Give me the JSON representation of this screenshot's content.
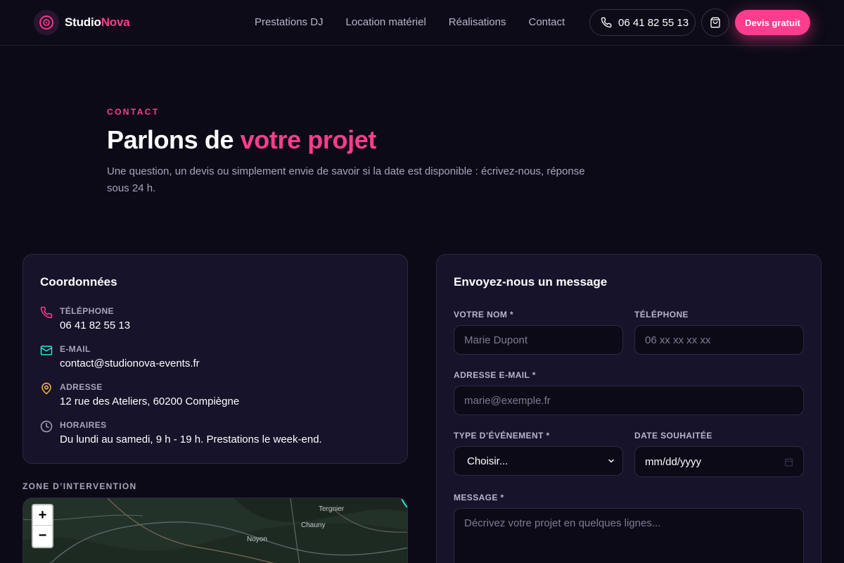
{
  "header": {
    "logo_part1": "Studio",
    "logo_part2": "Nova",
    "nav": [
      "Prestations DJ",
      "Location matériel",
      "Réalisations",
      "Contact"
    ],
    "phone": "06 41 82 55 13",
    "cta": "Devis gratuit"
  },
  "hero": {
    "eyebrow": "CONTACT",
    "title_plain": "Parlons de ",
    "title_highlight": "votre projet",
    "lead": "Une question, un devis ou simplement envie de savoir si la date est disponible : écrivez-nous, réponse sous 24 h."
  },
  "coords": {
    "title": "Coordonnées",
    "items": [
      {
        "label": "TÉLÉPHONE",
        "value": "06 41 82 55 13",
        "icon": "phone-icon",
        "color": "#ff3d8e"
      },
      {
        "label": "E-MAIL",
        "value": "contact@studionova-events.fr",
        "icon": "mail-icon",
        "color": "#2ee6d0"
      },
      {
        "label": "ADRESSE",
        "value": "12 rue des Ateliers, 60200 Compiègne",
        "icon": "map-pin-icon",
        "color": "#ffbb33"
      },
      {
        "label": "HORAIRES",
        "value": "Du lundi au samedi, 9 h - 19 h. Prestations le week-end.",
        "icon": "clock-icon",
        "color": "#a9a3bf"
      }
    ]
  },
  "zone": {
    "label": "ZONE D’INTERVENTION",
    "zoom_in": "+",
    "zoom_out": "−",
    "towns": [
      "Tergnier",
      "Chauny",
      "Noyon"
    ]
  },
  "form": {
    "title": "Envoyez-nous un message",
    "name_label": "VOTRE NOM *",
    "name_placeholder": "Marie Dupont",
    "phone_label": "TÉLÉPHONE",
    "phone_placeholder": "06 xx xx xx xx",
    "email_label": "ADRESSE E-MAIL *",
    "email_placeholder": "marie@exemple.fr",
    "event_label": "TYPE D’ÉVÉNEMENT *",
    "event_value": "Choisir...",
    "date_label": "DATE SOUHAITÉE",
    "date_value": "mm/dd/yyyy",
    "message_label": "MESSAGE *",
    "message_placeholder": "Décrivez votre projet en quelques lignes..."
  },
  "colors": {
    "accent": "#ff3d8e",
    "background": "#0c0a16",
    "card": "#16132a"
  }
}
